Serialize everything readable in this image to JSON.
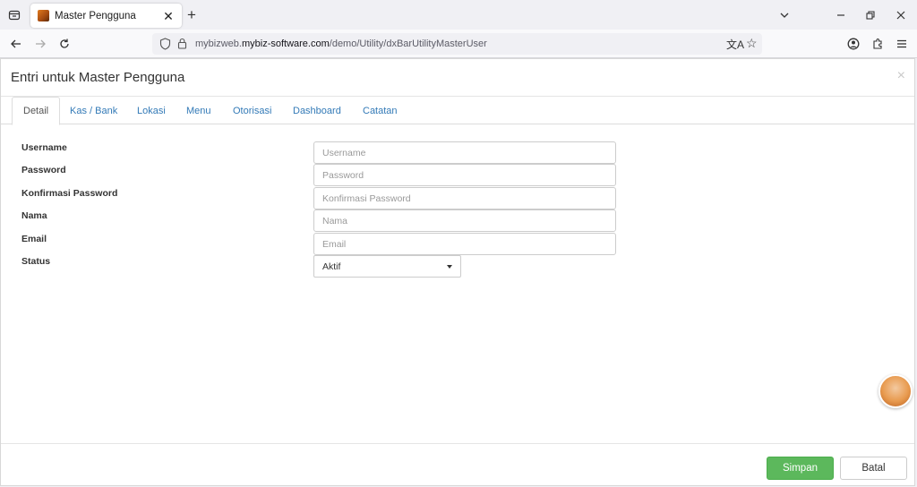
{
  "browser": {
    "tab_title": "Master Pengguna",
    "url_prefix": "mybizweb.",
    "url_domain": "mybiz-software.com",
    "url_path": "/demo/Utility/dxBarUtilityMasterUser"
  },
  "modal": {
    "title": "Entri untuk Master Pengguna",
    "close": "×",
    "tabs": [
      {
        "label": "Detail"
      },
      {
        "label": "Kas / Bank"
      },
      {
        "label": "Lokasi"
      },
      {
        "label": "Menu"
      },
      {
        "label": "Otorisasi"
      },
      {
        "label": "Dashboard"
      },
      {
        "label": "Catatan"
      }
    ],
    "fields": {
      "username": {
        "label": "Username",
        "placeholder": "Username",
        "value": ""
      },
      "password": {
        "label": "Password",
        "placeholder": "Password",
        "value": ""
      },
      "confirm": {
        "label": "Konfirmasi Password",
        "placeholder": "Konfirmasi Password",
        "value": ""
      },
      "nama": {
        "label": "Nama",
        "placeholder": "Nama",
        "value": ""
      },
      "email": {
        "label": "Email",
        "placeholder": "Email",
        "value": ""
      },
      "status": {
        "label": "Status",
        "value": "Aktif"
      }
    },
    "buttons": {
      "save": "Simpan",
      "cancel": "Batal"
    }
  },
  "colors": {
    "primary_button": "#5cb85c",
    "link": "#337ab7"
  }
}
